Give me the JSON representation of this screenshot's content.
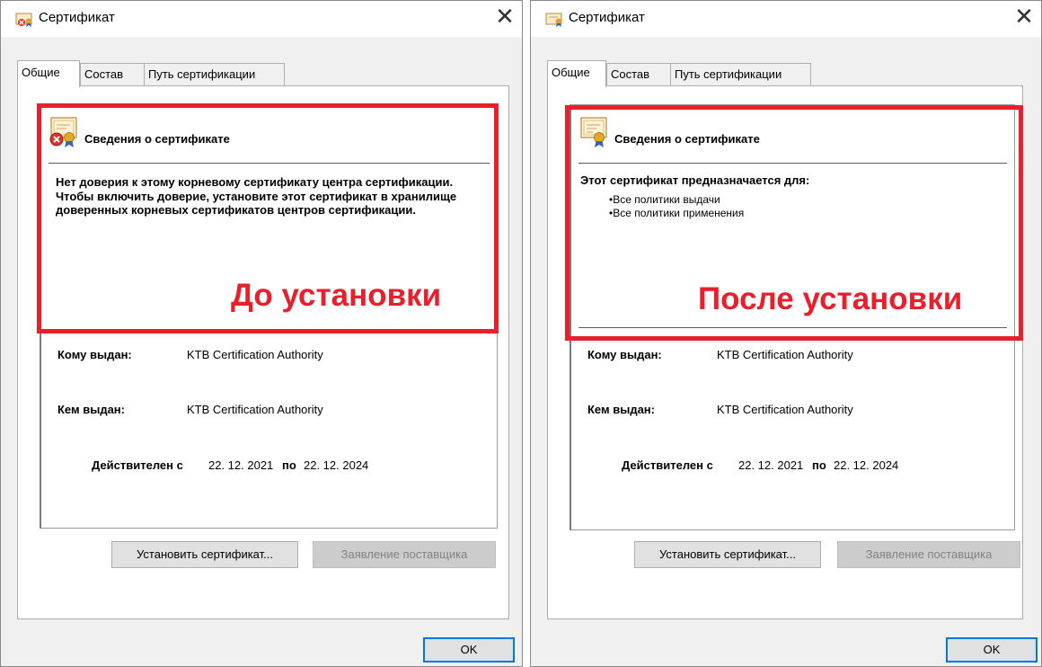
{
  "left": {
    "window_title": "Сертификат",
    "tabs": [
      {
        "label": "Общие"
      },
      {
        "label": "Состав"
      },
      {
        "label": "Путь сертификации"
      }
    ],
    "info_heading": "Сведения о сертификате",
    "message": "Нет доверия к этому корневому сертификату центра сертификации. Чтобы включить доверие, установите этот сертификат в хранилище доверенных корневых сертификатов центров сертификации.",
    "issued_to_label": "Кому выдан:",
    "issued_to_value": "KTB Certification Authority",
    "issued_by_label": "Кем выдан:",
    "issued_by_value": "KTB Certification Authority",
    "valid_from_label": "Действителен с",
    "valid_from_value": "22. 12. 2021",
    "valid_to_label": "по",
    "valid_to_value": "22. 12. 2024",
    "install_button": "Установить сертификат...",
    "issuer_statement_button": "Заявление поставщика",
    "ok_button": "OK",
    "annotation": "До установки"
  },
  "right": {
    "window_title": "Сертификат",
    "tabs": [
      {
        "label": "Общие"
      },
      {
        "label": "Состав"
      },
      {
        "label": "Путь сертификации"
      }
    ],
    "info_heading": "Сведения о сертификате",
    "purpose_heading": "Этот сертификат предназначается для:",
    "purposes": [
      "Все политики выдачи",
      "Все политики применения"
    ],
    "issued_to_label": "Кому выдан:",
    "issued_to_value": "KTB Certification Authority",
    "issued_by_label": "Кем выдан:",
    "issued_by_value": "KTB Certification Authority",
    "valid_from_label": "Действителен с",
    "valid_from_value": "22. 12. 2021",
    "valid_to_label": "по",
    "valid_to_value": "22. 12. 2024",
    "install_button": "Установить сертификат...",
    "issuer_statement_button": "Заявление поставщика",
    "ok_button": "OK",
    "annotation": "После установки"
  },
  "colors": {
    "annotation_red": "#e8202c",
    "dialog_bg": "#f0f0f0",
    "ok_border": "#0078d7"
  },
  "icons": {
    "title": "certificate-small-icon",
    "untrusted": "certificate-error-icon",
    "trusted": "certificate-icon",
    "close": "close-icon"
  }
}
